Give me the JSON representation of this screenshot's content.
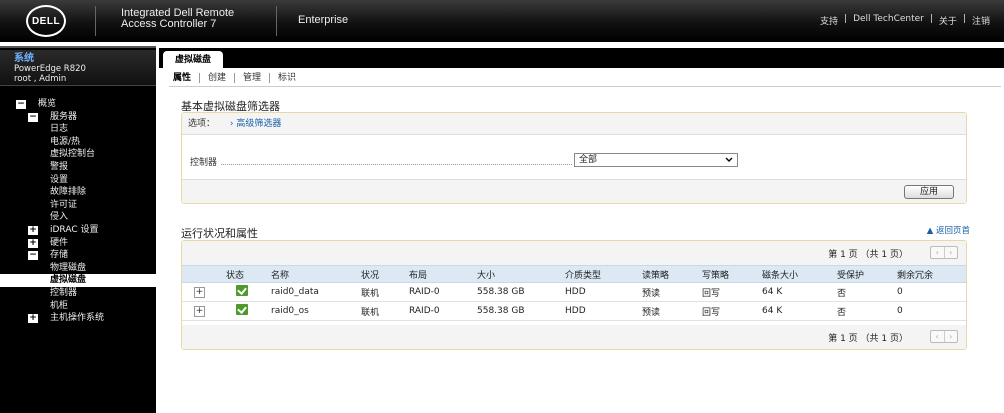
{
  "header": {
    "logo": "DELL",
    "product_line1": "Integrated Dell Remote",
    "product_line2": "Access Controller 7",
    "edition": "Enterprise",
    "links": [
      "支持",
      "Dell TechCenter",
      "关于",
      "注销"
    ],
    "link_sep": "|"
  },
  "sidebar": {
    "title": "系统",
    "model": "PowerEdge R820",
    "user": "root , Admin",
    "tree": [
      {
        "label": "概览",
        "toggle": "−"
      },
      {
        "label": "服务器",
        "toggle": "−"
      },
      {
        "label": "日志"
      },
      {
        "label": "电源/热"
      },
      {
        "label": "虚拟控制台"
      },
      {
        "label": "警报"
      },
      {
        "label": "设置"
      },
      {
        "label": "故障排除"
      },
      {
        "label": "许可证"
      },
      {
        "label": "侵入"
      },
      {
        "label": "iDRAC 设置",
        "toggle": "+"
      },
      {
        "label": "硬件",
        "toggle": "+"
      },
      {
        "label": "存储",
        "toggle": "−"
      },
      {
        "label": "物理磁盘"
      },
      {
        "label": "虚拟磁盘",
        "selected": true
      },
      {
        "label": "控制器"
      },
      {
        "label": "机柜"
      },
      {
        "label": "主机操作系统",
        "toggle": "+"
      }
    ]
  },
  "main": {
    "tab": "虚拟磁盘",
    "subtabs": [
      "属性",
      "创建",
      "管理",
      "标识"
    ],
    "filter": {
      "heading": "基本虚拟磁盘筛选器",
      "options_label": "选项：",
      "advanced_link": "› 高级筛选器",
      "controller_label": "控制器",
      "controller_value": "全部",
      "apply_label": "应用"
    },
    "status": {
      "heading": "运行状况和属性",
      "back_to_top": "▲ 返回页首",
      "pager_text": "第 1 页 （共 1 页）",
      "pager_prev": "‹",
      "pager_next": "›",
      "columns": [
        "",
        "状态",
        "名称",
        "状况",
        "布局",
        "大小",
        "介质类型",
        "读策略",
        "写策略",
        "磁条大小",
        "受保护",
        "剩余冗余"
      ],
      "rows": [
        {
          "expand": "+",
          "name": "raid0_data",
          "condition": "联机",
          "layout": "RAID-0",
          "size": "558.38 GB",
          "media": "HDD",
          "read": "预读",
          "write": "回写",
          "stripe": "64 K",
          "protected": "否",
          "redundancy": "0"
        },
        {
          "expand": "+",
          "name": "raid0_os",
          "condition": "联机",
          "layout": "RAID-0",
          "size": "558.38 GB",
          "media": "HDD",
          "read": "预读",
          "write": "回写",
          "stripe": "64 K",
          "protected": "否",
          "redundancy": "0"
        }
      ]
    }
  },
  "colors": {
    "link_blue": "#1a5fa8",
    "status_ok": "#4e9a2a",
    "table_header": "#dce9f5",
    "panel_border": "#e8d8a8"
  }
}
